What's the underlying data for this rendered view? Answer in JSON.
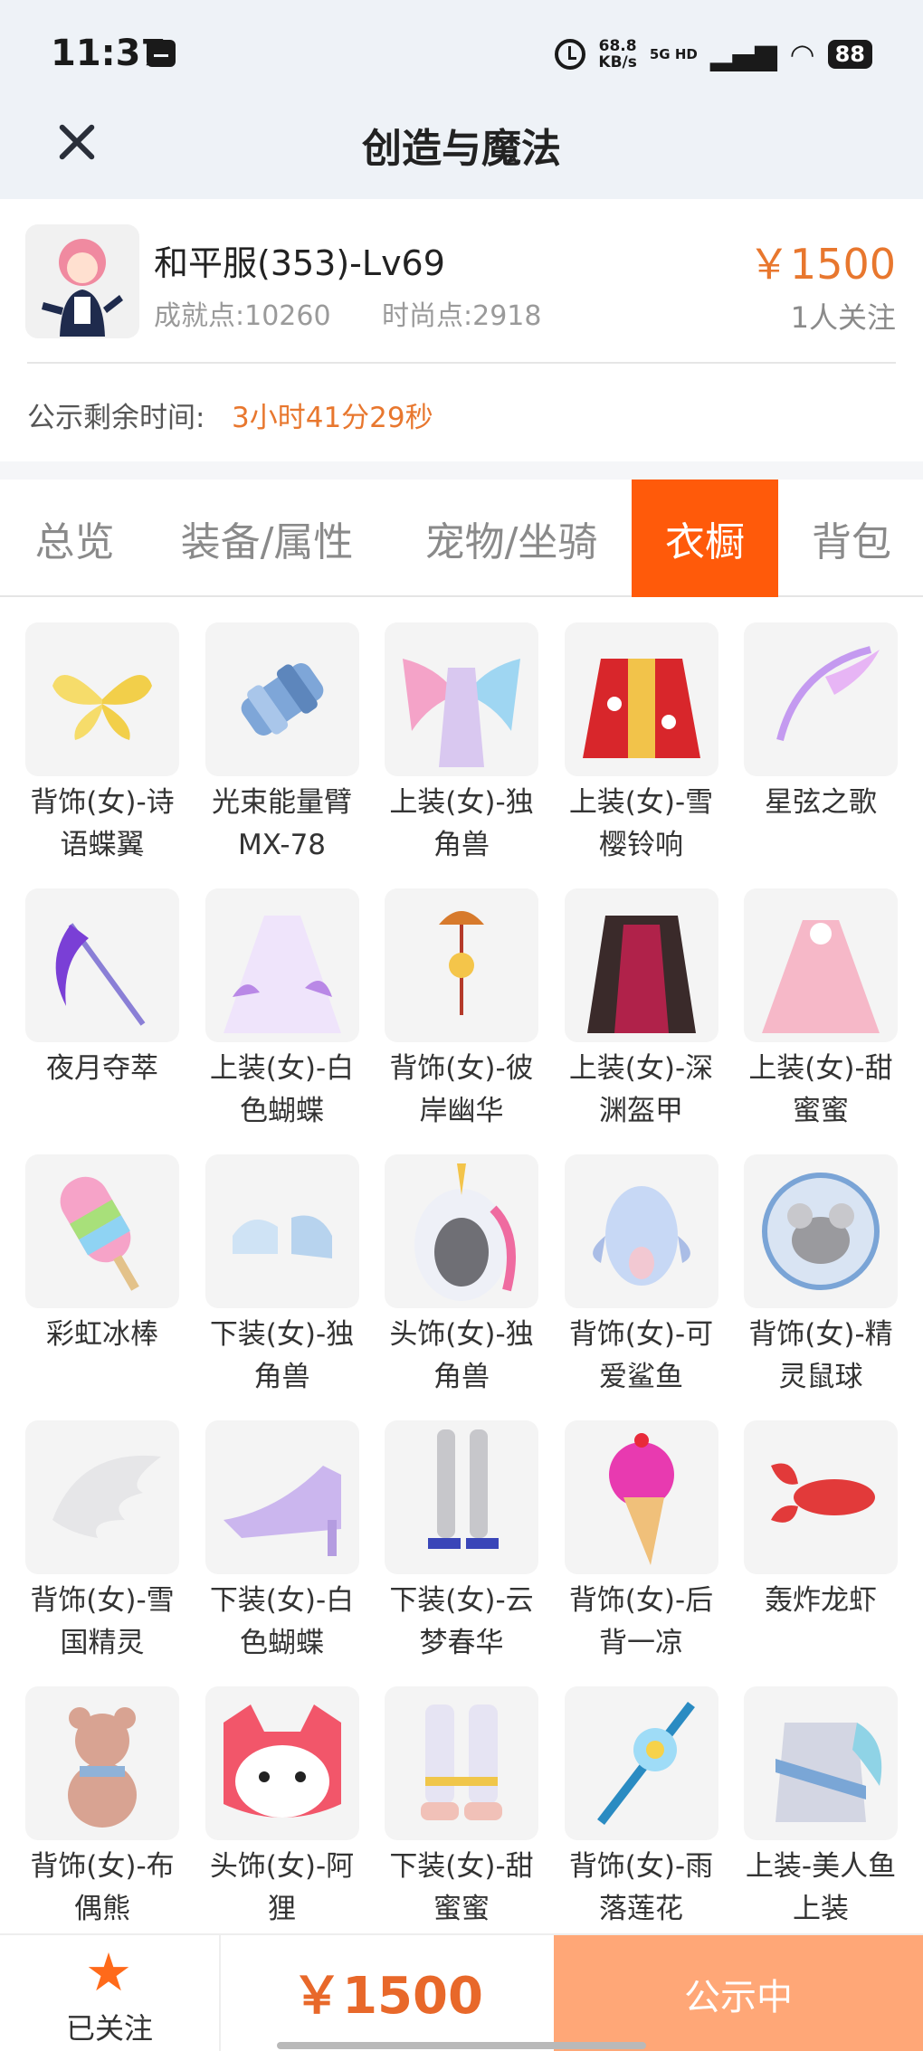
{
  "status_bar": {
    "time": "11:37",
    "net_speed": "68.8",
    "net_unit": "KB/s",
    "network": "5G HD",
    "battery": "88"
  },
  "header": {
    "title": "创造与魔法"
  },
  "account": {
    "server": "和平服(353)-Lv69",
    "achievement": "成就点:10260",
    "fashion": "时尚点:2918",
    "price": "￥1500",
    "followers": "1人关注",
    "countdown_label": "公示剩余时间:",
    "countdown_value": "3小时41分29秒"
  },
  "tabs": [
    {
      "label": "总览"
    },
    {
      "label": "装备/属性"
    },
    {
      "label": "宠物/坐骑"
    },
    {
      "label": "衣橱",
      "active": true
    },
    {
      "label": "背包"
    }
  ],
  "wardrobe": [
    {
      "name": "背饰(女)-诗语蝶翼",
      "icon": "butterfly-wings-icon"
    },
    {
      "name": "光束能量臂MX-78",
      "icon": "energy-arm-icon"
    },
    {
      "name": "上装(女)-独角兽",
      "icon": "winged-dress-icon"
    },
    {
      "name": "上装(女)-雪樱铃响",
      "icon": "red-kimono-icon"
    },
    {
      "name": "星弦之歌",
      "icon": "star-bow-icon"
    },
    {
      "name": "夜月夺萃",
      "icon": "moon-scythe-icon"
    },
    {
      "name": "上装(女)-白色蝴蝶",
      "icon": "white-dress-icon"
    },
    {
      "name": "背饰(女)-彼岸幽华",
      "icon": "fan-charm-icon"
    },
    {
      "name": "上装(女)-深渊盔甲",
      "icon": "abyss-armor-icon"
    },
    {
      "name": "上装(女)-甜蜜蜜",
      "icon": "pink-dress-icon"
    },
    {
      "name": "彩虹冰棒",
      "icon": "rainbow-popsicle-icon"
    },
    {
      "name": "下装(女)-独角兽",
      "icon": "unicorn-shoes-icon"
    },
    {
      "name": "头饰(女)-独角兽",
      "icon": "unicorn-hood-icon"
    },
    {
      "name": "背饰(女)-可爱鲨鱼",
      "icon": "shark-plush-icon"
    },
    {
      "name": "背饰(女)-精灵鼠球",
      "icon": "mouse-ball-icon"
    },
    {
      "name": "背饰(女)-雪国精灵",
      "icon": "snow-wing-icon"
    },
    {
      "name": "下装(女)-白色蝴蝶",
      "icon": "heel-shoe-icon"
    },
    {
      "name": "下装(女)-云梦春华",
      "icon": "sandal-legs-icon"
    },
    {
      "name": "背饰(女)-后背一凉",
      "icon": "icecream-cone-icon"
    },
    {
      "name": "轰炸龙虾",
      "icon": "lobster-icon"
    },
    {
      "name": "背饰(女)-布偶熊",
      "icon": "teddy-bear-icon"
    },
    {
      "name": "头饰(女)-阿狸",
      "icon": "ali-fox-mask-icon"
    },
    {
      "name": "下装(女)-甜蜜蜜",
      "icon": "white-boots-icon"
    },
    {
      "name": "背饰(女)-雨落莲花",
      "icon": "lotus-staff-icon"
    },
    {
      "name": "上装-美人鱼上装",
      "icon": "mermaid-top-icon"
    }
  ],
  "bottom": {
    "follow_label": "已关注",
    "price": "￥1500",
    "status": "公示中"
  },
  "colors": {
    "accent": "#ff5a0a",
    "price": "#e8772e",
    "button": "#ffa777"
  }
}
